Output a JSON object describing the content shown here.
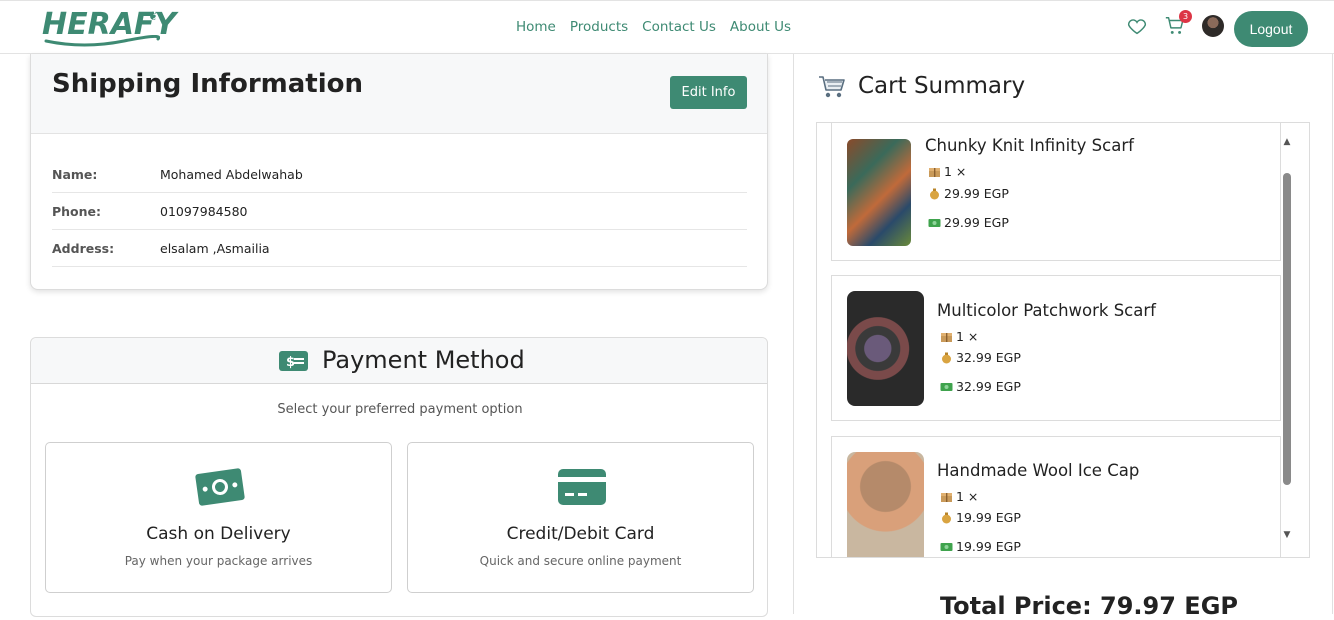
{
  "brand": {
    "name": "HERAFY",
    "accent": "#3e8a73"
  },
  "nav": {
    "links": [
      "Home",
      "Products",
      "Contact Us",
      "About Us"
    ],
    "cart_count": "3",
    "logout_label": "Logout"
  },
  "shipping": {
    "title": "Shipping Information",
    "edit_label": "Edit Info",
    "rows": [
      {
        "label": "Name:",
        "value": "Mohamed Abdelwahab"
      },
      {
        "label": "Phone:",
        "value": "01097984580"
      },
      {
        "label": "Address:",
        "value": "elsalam ,Asmailia"
      }
    ]
  },
  "payment": {
    "title": "Payment Method",
    "subtitle": "Select your preferred payment option",
    "options": [
      {
        "title": "Cash on Delivery",
        "desc": "Pay when your package arrives",
        "icon": "cash-icon"
      },
      {
        "title": "Credit/Debit Card",
        "desc": "Quick and secure online payment",
        "icon": "credit-card-icon"
      }
    ]
  },
  "cart": {
    "title": "Cart Summary",
    "items": [
      {
        "name": "Chunky Knit Infinity Scarf",
        "qty": "1 ×",
        "price": "29.99 EGP",
        "subtotal": "29.99 EGP"
      },
      {
        "name": "Multicolor Patchwork Scarf",
        "qty": "1 ×",
        "price": "32.99 EGP",
        "subtotal": "32.99 EGP"
      },
      {
        "name": "Handmade Wool Ice Cap",
        "qty": "1 ×",
        "price": "19.99 EGP",
        "subtotal": "19.99 EGP"
      }
    ],
    "total_peek": "Total Price: 79.97 EGP"
  }
}
